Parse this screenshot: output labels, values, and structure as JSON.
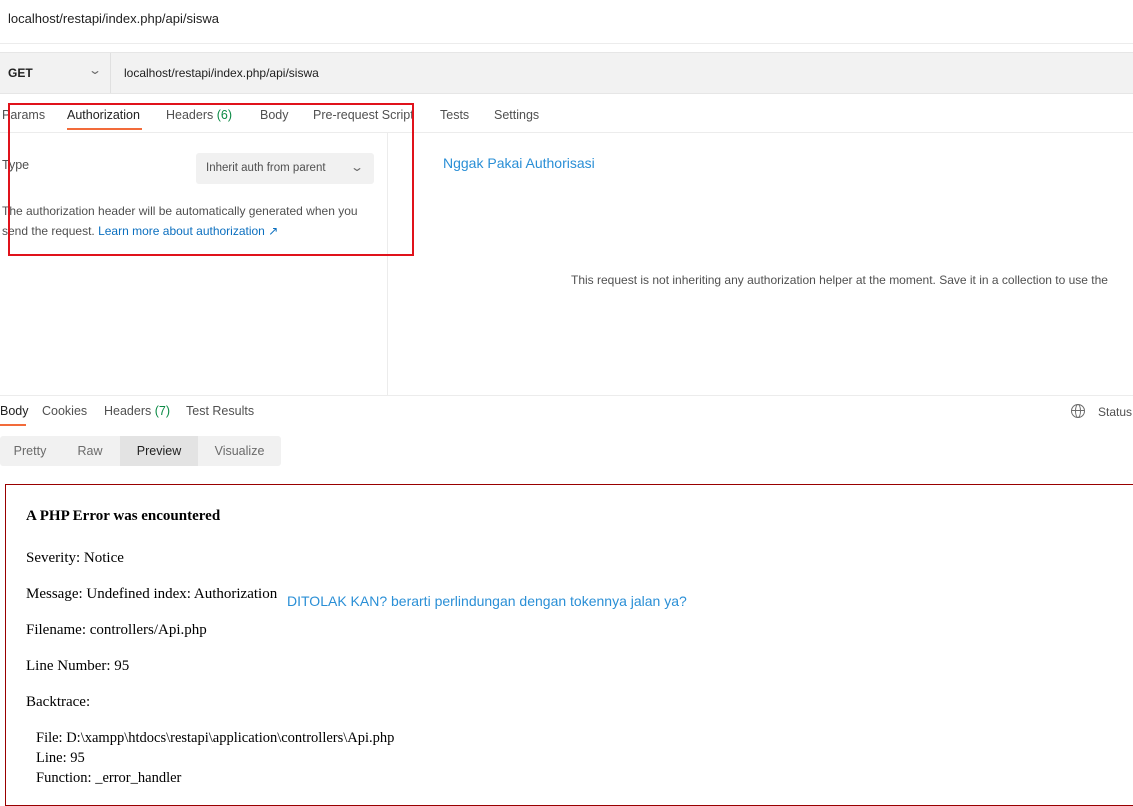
{
  "request": {
    "title": "localhost/restapi/index.php/api/siswa",
    "method": "GET",
    "url": "localhost/restapi/index.php/api/siswa"
  },
  "tabs": {
    "params": "Params",
    "authorization": "Authorization",
    "headers": "Headers",
    "headers_count": "(6)",
    "body": "Body",
    "prerequest": "Pre-request Script",
    "tests": "Tests",
    "settings": "Settings"
  },
  "auth": {
    "type_label": "Type",
    "select_value": "Inherit auth from parent",
    "description": "The authorization header will be automatically generated when you send the request.",
    "learn_more": "Learn more about authorization ↗",
    "info": "This request is not inheriting any authorization helper at the moment. Save it in a collection to use the"
  },
  "annotations": {
    "note1": "Nggak Pakai Authorisasi",
    "note2": "DITOLAK KAN? berarti perlindungan dengan tokennya jalan ya?"
  },
  "response": {
    "tabs": {
      "body": "Body",
      "cookies": "Cookies",
      "headers": "Headers",
      "headers_count": "(7)",
      "test_results": "Test Results"
    },
    "status_label": "Status:",
    "views": [
      "Pretty",
      "Raw",
      "Preview",
      "Visualize"
    ],
    "active_view": "Preview"
  },
  "php_error": {
    "heading": "A PHP Error was encountered",
    "severity": "Severity: Notice",
    "message": "Message: Undefined index: Authorization",
    "filename": "Filename: controllers/Api.php",
    "line_number": "Line Number: 95",
    "backtrace": "Backtrace:",
    "bt_file": "File: D:\\xampp\\htdocs\\restapi\\application\\controllers\\Api.php",
    "bt_line": "Line: 95",
    "bt_function": "Function: _error_handler"
  },
  "colors": {
    "accent_tab": "#f26b3a",
    "annotation_box": "#e0121b",
    "annotation_text": "#2a8fd6",
    "link": "#0b6fbf",
    "count_green": "#0b8a45"
  }
}
